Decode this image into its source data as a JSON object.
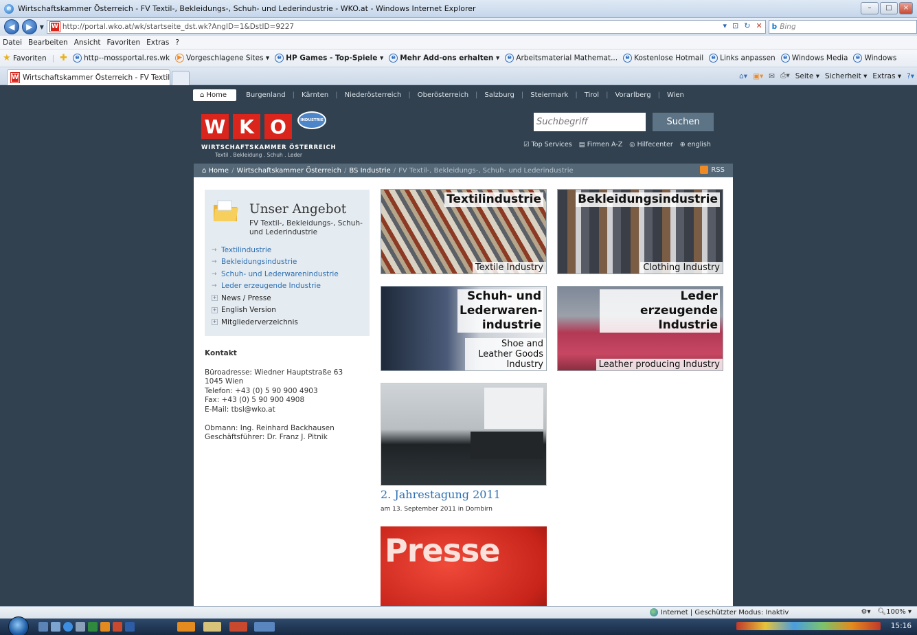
{
  "window": {
    "title": "Wirtschaftskammer Österreich - FV Textil-, Bekleidungs-, Schuh- und Lederindustrie - WKO.at - Windows Internet Explorer"
  },
  "addressbar": {
    "url": "http://portal.wko.at/wk/startseite_dst.wk?AngID=1&DstID=9227",
    "search_placeholder": "Bing"
  },
  "menubar": [
    "Datei",
    "Bearbeiten",
    "Ansicht",
    "Favoriten",
    "Extras",
    "?"
  ],
  "favorites": {
    "label": "Favoriten",
    "items": [
      "http--mossportal.res.wk",
      "Vorgeschlagene Sites ▾",
      "HP Games - Top-Spiele ▾",
      "Mehr Add-ons erhalten ▾",
      "Arbeitsmaterial Mathemat...",
      "Kostenlose Hotmail",
      "Links anpassen",
      "Windows Media",
      "Windows"
    ]
  },
  "tab": {
    "label": "Wirtschaftskammer Österreich - FV Textil-, Beklei..."
  },
  "commandbar": [
    "Seite ▾",
    "Sicherheit ▾",
    "Extras ▾"
  ],
  "page": {
    "topnav": [
      "Home",
      "Burgenland",
      "Kärnten",
      "Niederösterreich",
      "Oberösterreich",
      "Salzburg",
      "Steiermark",
      "Tirol",
      "Vorarlberg",
      "Wien"
    ],
    "logo": {
      "letters": [
        "W",
        "K",
        "O"
      ],
      "badge": "INDUSTRIE",
      "name": "WIRTSCHAFTSKAMMER ÖSTERREICH",
      "sub": "Textil . Bekleidung . Schuh . Leder"
    },
    "search": {
      "placeholder": "Suchbegriff",
      "button": "Suchen"
    },
    "services": [
      "Top Services",
      "Firmen A-Z",
      "Hilfecenter",
      "english"
    ],
    "breadcrumb": [
      "Home",
      "Wirtschaftskammer Österreich",
      "BS Industrie",
      "FV Textil-, Bekleidungs-, Schuh- und Lederindustrie"
    ],
    "rss": "RSS",
    "sidebar": {
      "title": "Unser Angebot",
      "subtitle": "FV Textil-, Bekleidungs-, Schuh- und Lederindustrie",
      "links": [
        "Textilindustrie",
        "Bekleidungsindustrie",
        "Schuh- und Lederwarenindustrie",
        "Leder erzeugende Industrie"
      ],
      "expandables": [
        "News / Presse",
        "English Version",
        "Mitgliederverzeichnis"
      ]
    },
    "kontakt": {
      "heading": "Kontakt",
      "lines": [
        "Büroadresse: Wiedner Hauptstraße 63",
        "1045 Wien",
        "Telefon: +43 (0) 5 90 900 4903",
        "Fax: +43 (0) 5 90 900 4908",
        "E-Mail: tbsl@wko.at"
      ],
      "lines2": [
        "Obmann: Ing. Reinhard Backhausen",
        "Geschäftsführer: Dr. Franz J. Pitnik"
      ]
    },
    "tiles": [
      {
        "title": "Textilindustrie",
        "subtitle": "Textile Industry"
      },
      {
        "title": "Bekleidungsindustrie",
        "subtitle": "Clothing Industry"
      },
      {
        "title": "Schuh- und Lederwaren-industrie",
        "subtitle": "Shoe and Leather Goods Industry"
      },
      {
        "title": "Leder erzeugende Industrie",
        "subtitle": "Leather producing Industry"
      }
    ],
    "event": {
      "title": "2. Jahrestagung 2011",
      "date": "am 13. September 2011 in Dornbirn"
    },
    "presse": "Presse"
  },
  "statusbar": {
    "zone": "Internet | Geschützter Modus: Inaktiv",
    "zoom": "100%"
  },
  "taskbar": {
    "clock": "15:16"
  }
}
